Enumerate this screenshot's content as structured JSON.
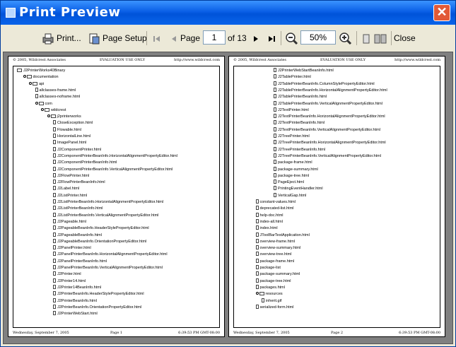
{
  "window": {
    "title": "Print Preview",
    "close_glyph": "✕"
  },
  "toolbar": {
    "print_label": "Print...",
    "page_setup_label": "Page Setup",
    "page_label": "Page",
    "page_value": "1",
    "of_label": "of 13",
    "zoom_value": "50%",
    "close_label": "Close"
  },
  "page1": {
    "header_left": "© 2005, Wildcrest Associates",
    "header_center": "EVALUATION USE ONLY",
    "header_right": "http://www.wildcrest.com",
    "footer_left": "Wednesday, September 7, 2005",
    "footer_center": "Page 1",
    "footer_right": "6:39:53 PM GMT-08:00",
    "items": [
      {
        "text": "J2PrinterWorks40Binary",
        "level": 0,
        "type": "folder",
        "knob": false
      },
      {
        "text": "documentation",
        "level": 1,
        "type": "folder",
        "knob": true
      },
      {
        "text": "api",
        "level": 2,
        "type": "folder",
        "knob": true
      },
      {
        "text": "allclasses-frame.html",
        "level": 3,
        "type": "file",
        "knob": false
      },
      {
        "text": "allclasses-noframe.html",
        "level": 3,
        "type": "file",
        "knob": false
      },
      {
        "text": "com",
        "level": 3,
        "type": "folder",
        "knob": true
      },
      {
        "text": "wildcrest",
        "level": 4,
        "type": "folder",
        "knob": true
      },
      {
        "text": "j2printerworks",
        "level": 5,
        "type": "folder",
        "knob": true
      },
      {
        "text": "CloseException.html",
        "level": 6,
        "type": "file",
        "knob": false
      },
      {
        "text": "Flowable.html",
        "level": 6,
        "type": "file",
        "knob": false
      },
      {
        "text": "HorizontalLine.html",
        "level": 6,
        "type": "file",
        "knob": false
      },
      {
        "text": "ImagePanel.html",
        "level": 6,
        "type": "file",
        "knob": false
      },
      {
        "text": "J2ComponentPrinter.html",
        "level": 6,
        "type": "file",
        "knob": false
      },
      {
        "text": "J2ComponentPrinterBeanInfo.HorizontalAlignmentPropertyEditor.html",
        "level": 6,
        "type": "file",
        "knob": false
      },
      {
        "text": "J2ComponentPrinterBeanInfo.html",
        "level": 6,
        "type": "file",
        "knob": false
      },
      {
        "text": "J2ComponentPrinterBeanInfo.VerticalAlignmentPropertyEditor.html",
        "level": 6,
        "type": "file",
        "knob": false
      },
      {
        "text": "J2FlowPrinter.html",
        "level": 6,
        "type": "file",
        "knob": false
      },
      {
        "text": "J2FlowPrinterBeanInfo.html",
        "level": 6,
        "type": "file",
        "knob": false
      },
      {
        "text": "J2Label.html",
        "level": 6,
        "type": "file",
        "knob": false
      },
      {
        "text": "J2ListPrinter.html",
        "level": 6,
        "type": "file",
        "knob": false
      },
      {
        "text": "J2ListPrinterBeanInfo.HorizontalAlignmentPropertyEditor.html",
        "level": 6,
        "type": "file",
        "knob": false
      },
      {
        "text": "J2ListPrinterBeanInfo.html",
        "level": 6,
        "type": "file",
        "knob": false
      },
      {
        "text": "J2ListPrinterBeanInfo.VerticalAlignmentPropertyEditor.html",
        "level": 6,
        "type": "file",
        "knob": false
      },
      {
        "text": "J2Pageable.html",
        "level": 6,
        "type": "file",
        "knob": false
      },
      {
        "text": "J2PageableBeanInfo.HeaderStylePropertyEditor.html",
        "level": 6,
        "type": "file",
        "knob": false
      },
      {
        "text": "J2PageableBeanInfo.html",
        "level": 6,
        "type": "file",
        "knob": false
      },
      {
        "text": "J2PageableBeanInfo.OrientationPropertyEditor.html",
        "level": 6,
        "type": "file",
        "knob": false
      },
      {
        "text": "J2PanelPrinter.html",
        "level": 6,
        "type": "file",
        "knob": false
      },
      {
        "text": "J2PanelPrinterBeanInfo.HorizontalAlignmentPropertyEditor.html",
        "level": 6,
        "type": "file",
        "knob": false
      },
      {
        "text": "J2PanelPrinterBeanInfo.html",
        "level": 6,
        "type": "file",
        "knob": false
      },
      {
        "text": "J2PanelPrinterBeanInfo.VerticalAlignmentPropertyEditor.html",
        "level": 6,
        "type": "file",
        "knob": false
      },
      {
        "text": "J2Printer.html",
        "level": 6,
        "type": "file",
        "knob": false
      },
      {
        "text": "J2Printer14.html",
        "level": 6,
        "type": "file",
        "knob": false
      },
      {
        "text": "J2Printer14BeanInfo.html",
        "level": 6,
        "type": "file",
        "knob": false
      },
      {
        "text": "J2PrinterBeanInfo.HeaderStylePropertyEditor.html",
        "level": 6,
        "type": "file",
        "knob": false
      },
      {
        "text": "J2PrinterBeanInfo.html",
        "level": 6,
        "type": "file",
        "knob": false
      },
      {
        "text": "J2PrinterBeanInfo.OrientationPropertyEditor.html",
        "level": 6,
        "type": "file",
        "knob": false
      },
      {
        "text": "J2PrinterWebStart.html",
        "level": 6,
        "type": "file",
        "knob": false
      }
    ]
  },
  "page2": {
    "header_left": "© 2005, Wildcrest Associates",
    "header_center": "EVALUATION USE ONLY",
    "header_right": "http://www.wildcrest.com",
    "footer_left": "Wednesday, September 7, 2005",
    "footer_center": "Page 2",
    "footer_right": "6:39:53 PM GMT-08:00",
    "items": [
      {
        "text": "J2PrinterWebStartBeanInfo.html",
        "level": 6,
        "type": "file",
        "knob": false
      },
      {
        "text": "J2TablePrinter.html",
        "level": 6,
        "type": "file",
        "knob": false
      },
      {
        "text": "J2TablePrinterBeanInfo.ColumnStylePropertyEditor.html",
        "level": 6,
        "type": "file",
        "knob": false
      },
      {
        "text": "J2TablePrinterBeanInfo.HorizontalAlignmentPropertyEditor.html",
        "level": 6,
        "type": "file",
        "knob": false
      },
      {
        "text": "J2TablePrinterBeanInfo.html",
        "level": 6,
        "type": "file",
        "knob": false
      },
      {
        "text": "J2TablePrinterBeanInfo.VerticalAlignmentPropertyEditor.html",
        "level": 6,
        "type": "file",
        "knob": false
      },
      {
        "text": "J2TextPrinter.html",
        "level": 6,
        "type": "file",
        "knob": false
      },
      {
        "text": "J2TextPrinterBeanInfo.HorizontalAlignmentPropertyEditor.html",
        "level": 6,
        "type": "file",
        "knob": false
      },
      {
        "text": "J2TextPrinterBeanInfo.html",
        "level": 6,
        "type": "file",
        "knob": false
      },
      {
        "text": "J2TextPrinterBeanInfo.VerticalAlignmentPropertyEditor.html",
        "level": 6,
        "type": "file",
        "knob": false
      },
      {
        "text": "J2TreePrinter.html",
        "level": 6,
        "type": "file",
        "knob": false
      },
      {
        "text": "J2TreePrinterBeanInfo.HorizontalAlignmentPropertyEditor.html",
        "level": 6,
        "type": "file",
        "knob": false
      },
      {
        "text": "J2TreePrinterBeanInfo.html",
        "level": 6,
        "type": "file",
        "knob": false
      },
      {
        "text": "J2TreePrinterBeanInfo.VerticalAlignmentPropertyEditor.html",
        "level": 6,
        "type": "file",
        "knob": false
      },
      {
        "text": "package-frame.html",
        "level": 6,
        "type": "file",
        "knob": false
      },
      {
        "text": "package-summary.html",
        "level": 6,
        "type": "file",
        "knob": false
      },
      {
        "text": "package-tree.html",
        "level": 6,
        "type": "file",
        "knob": false
      },
      {
        "text": "PageEject.html",
        "level": 6,
        "type": "file",
        "knob": false
      },
      {
        "text": "PrintingEventHandler.html",
        "level": 6,
        "type": "file",
        "knob": false
      },
      {
        "text": "VerticalGap.html",
        "level": 6,
        "type": "file",
        "knob": false
      },
      {
        "text": "constant-values.html",
        "level": 3,
        "type": "file",
        "knob": false
      },
      {
        "text": "deprecated-list.html",
        "level": 3,
        "type": "file",
        "knob": false
      },
      {
        "text": "help-doc.html",
        "level": 3,
        "type": "file",
        "knob": false
      },
      {
        "text": "index-all.html",
        "level": 3,
        "type": "file",
        "knob": false
      },
      {
        "text": "index.html",
        "level": 3,
        "type": "file",
        "knob": false
      },
      {
        "text": "JToolBarTestApplication.html",
        "level": 3,
        "type": "file",
        "knob": false
      },
      {
        "text": "overview-frame.html",
        "level": 3,
        "type": "file",
        "knob": false
      },
      {
        "text": "overview-summary.html",
        "level": 3,
        "type": "file",
        "knob": false
      },
      {
        "text": "overview-tree.html",
        "level": 3,
        "type": "file",
        "knob": false
      },
      {
        "text": "package-frame.html",
        "level": 3,
        "type": "file",
        "knob": false
      },
      {
        "text": "package-list",
        "level": 3,
        "type": "file",
        "knob": false
      },
      {
        "text": "package-summary.html",
        "level": 3,
        "type": "file",
        "knob": false
      },
      {
        "text": "package-tree.html",
        "level": 3,
        "type": "file",
        "knob": false
      },
      {
        "text": "packages.html",
        "level": 3,
        "type": "file",
        "knob": false
      },
      {
        "text": "resources",
        "level": 3,
        "type": "folder",
        "knob": true
      },
      {
        "text": "inherit.gif",
        "level": 4,
        "type": "file",
        "knob": false
      },
      {
        "text": "serialized-form.html",
        "level": 3,
        "type": "file",
        "knob": false
      }
    ]
  }
}
